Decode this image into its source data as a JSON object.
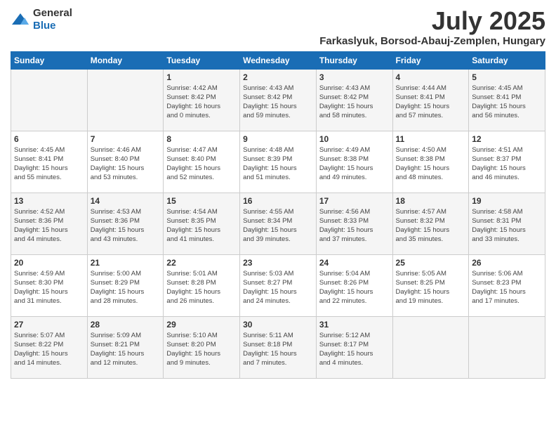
{
  "header": {
    "logo_general": "General",
    "logo_blue": "Blue",
    "month": "July 2025",
    "location": "Farkaslyuk, Borsod-Abauj-Zemplen, Hungary"
  },
  "weekdays": [
    "Sunday",
    "Monday",
    "Tuesday",
    "Wednesday",
    "Thursday",
    "Friday",
    "Saturday"
  ],
  "weeks": [
    [
      {
        "day": "",
        "info": ""
      },
      {
        "day": "",
        "info": ""
      },
      {
        "day": "1",
        "info": "Sunrise: 4:42 AM\nSunset: 8:42 PM\nDaylight: 16 hours\nand 0 minutes."
      },
      {
        "day": "2",
        "info": "Sunrise: 4:43 AM\nSunset: 8:42 PM\nDaylight: 15 hours\nand 59 minutes."
      },
      {
        "day": "3",
        "info": "Sunrise: 4:43 AM\nSunset: 8:42 PM\nDaylight: 15 hours\nand 58 minutes."
      },
      {
        "day": "4",
        "info": "Sunrise: 4:44 AM\nSunset: 8:41 PM\nDaylight: 15 hours\nand 57 minutes."
      },
      {
        "day": "5",
        "info": "Sunrise: 4:45 AM\nSunset: 8:41 PM\nDaylight: 15 hours\nand 56 minutes."
      }
    ],
    [
      {
        "day": "6",
        "info": "Sunrise: 4:45 AM\nSunset: 8:41 PM\nDaylight: 15 hours\nand 55 minutes."
      },
      {
        "day": "7",
        "info": "Sunrise: 4:46 AM\nSunset: 8:40 PM\nDaylight: 15 hours\nand 53 minutes."
      },
      {
        "day": "8",
        "info": "Sunrise: 4:47 AM\nSunset: 8:40 PM\nDaylight: 15 hours\nand 52 minutes."
      },
      {
        "day": "9",
        "info": "Sunrise: 4:48 AM\nSunset: 8:39 PM\nDaylight: 15 hours\nand 51 minutes."
      },
      {
        "day": "10",
        "info": "Sunrise: 4:49 AM\nSunset: 8:38 PM\nDaylight: 15 hours\nand 49 minutes."
      },
      {
        "day": "11",
        "info": "Sunrise: 4:50 AM\nSunset: 8:38 PM\nDaylight: 15 hours\nand 48 minutes."
      },
      {
        "day": "12",
        "info": "Sunrise: 4:51 AM\nSunset: 8:37 PM\nDaylight: 15 hours\nand 46 minutes."
      }
    ],
    [
      {
        "day": "13",
        "info": "Sunrise: 4:52 AM\nSunset: 8:36 PM\nDaylight: 15 hours\nand 44 minutes."
      },
      {
        "day": "14",
        "info": "Sunrise: 4:53 AM\nSunset: 8:36 PM\nDaylight: 15 hours\nand 43 minutes."
      },
      {
        "day": "15",
        "info": "Sunrise: 4:54 AM\nSunset: 8:35 PM\nDaylight: 15 hours\nand 41 minutes."
      },
      {
        "day": "16",
        "info": "Sunrise: 4:55 AM\nSunset: 8:34 PM\nDaylight: 15 hours\nand 39 minutes."
      },
      {
        "day": "17",
        "info": "Sunrise: 4:56 AM\nSunset: 8:33 PM\nDaylight: 15 hours\nand 37 minutes."
      },
      {
        "day": "18",
        "info": "Sunrise: 4:57 AM\nSunset: 8:32 PM\nDaylight: 15 hours\nand 35 minutes."
      },
      {
        "day": "19",
        "info": "Sunrise: 4:58 AM\nSunset: 8:31 PM\nDaylight: 15 hours\nand 33 minutes."
      }
    ],
    [
      {
        "day": "20",
        "info": "Sunrise: 4:59 AM\nSunset: 8:30 PM\nDaylight: 15 hours\nand 31 minutes."
      },
      {
        "day": "21",
        "info": "Sunrise: 5:00 AM\nSunset: 8:29 PM\nDaylight: 15 hours\nand 28 minutes."
      },
      {
        "day": "22",
        "info": "Sunrise: 5:01 AM\nSunset: 8:28 PM\nDaylight: 15 hours\nand 26 minutes."
      },
      {
        "day": "23",
        "info": "Sunrise: 5:03 AM\nSunset: 8:27 PM\nDaylight: 15 hours\nand 24 minutes."
      },
      {
        "day": "24",
        "info": "Sunrise: 5:04 AM\nSunset: 8:26 PM\nDaylight: 15 hours\nand 22 minutes."
      },
      {
        "day": "25",
        "info": "Sunrise: 5:05 AM\nSunset: 8:25 PM\nDaylight: 15 hours\nand 19 minutes."
      },
      {
        "day": "26",
        "info": "Sunrise: 5:06 AM\nSunset: 8:23 PM\nDaylight: 15 hours\nand 17 minutes."
      }
    ],
    [
      {
        "day": "27",
        "info": "Sunrise: 5:07 AM\nSunset: 8:22 PM\nDaylight: 15 hours\nand 14 minutes."
      },
      {
        "day": "28",
        "info": "Sunrise: 5:09 AM\nSunset: 8:21 PM\nDaylight: 15 hours\nand 12 minutes."
      },
      {
        "day": "29",
        "info": "Sunrise: 5:10 AM\nSunset: 8:20 PM\nDaylight: 15 hours\nand 9 minutes."
      },
      {
        "day": "30",
        "info": "Sunrise: 5:11 AM\nSunset: 8:18 PM\nDaylight: 15 hours\nand 7 minutes."
      },
      {
        "day": "31",
        "info": "Sunrise: 5:12 AM\nSunset: 8:17 PM\nDaylight: 15 hours\nand 4 minutes."
      },
      {
        "day": "",
        "info": ""
      },
      {
        "day": "",
        "info": ""
      }
    ]
  ]
}
